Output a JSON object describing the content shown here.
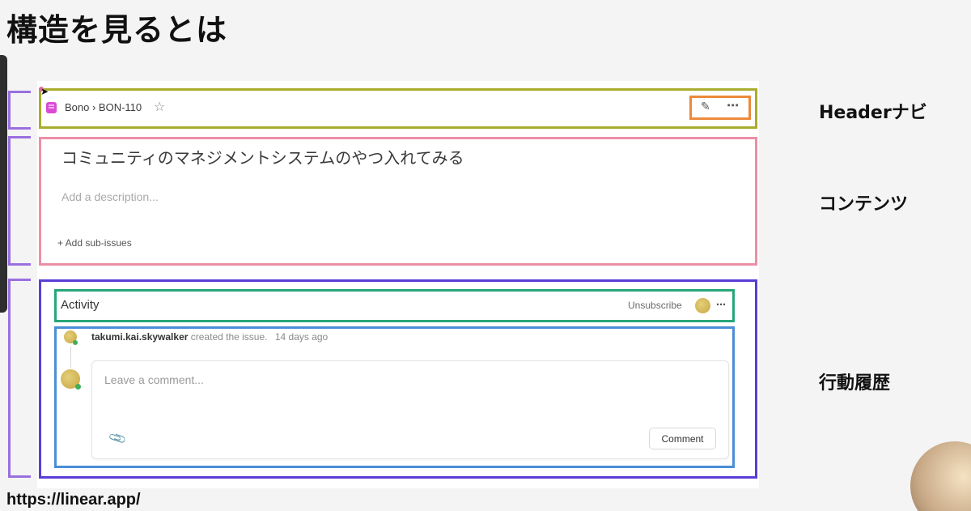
{
  "slide": {
    "title": "構造を見るとは",
    "source_url": "https://linear.app/"
  },
  "labels": {
    "header": "Headerナビ",
    "content": "コンテンツ",
    "activity": "行動履歴"
  },
  "header_nav": {
    "breadcrumb": "Bono › BON-110",
    "project_icon": "project-book-icon",
    "star_icon": "star-icon",
    "edit_icon": "pencil-icon",
    "more_icon": "more-icon"
  },
  "content": {
    "issue_title": "コミュニティのマネジメントシステムのやつ入れてみる",
    "description_placeholder": "Add a description...",
    "add_sub_issues": "+ Add sub-issues"
  },
  "activity": {
    "title": "Activity",
    "unsubscribe": "Unsubscribe",
    "event": {
      "user": "takumi.kai.skywalker",
      "action": "created the issue.",
      "time": "14 days ago"
    },
    "comment_placeholder": "Leave a comment...",
    "comment_button": "Comment"
  },
  "colors": {
    "header_box": "#a9ad2e",
    "actions_box": "#ec8a3c",
    "content_box": "#ec8fa6",
    "activity_box": "#5a3dd6",
    "activity_header_box": "#27a679",
    "activity_body_box": "#4a8ed6",
    "bracket": "#9a6fe0"
  }
}
